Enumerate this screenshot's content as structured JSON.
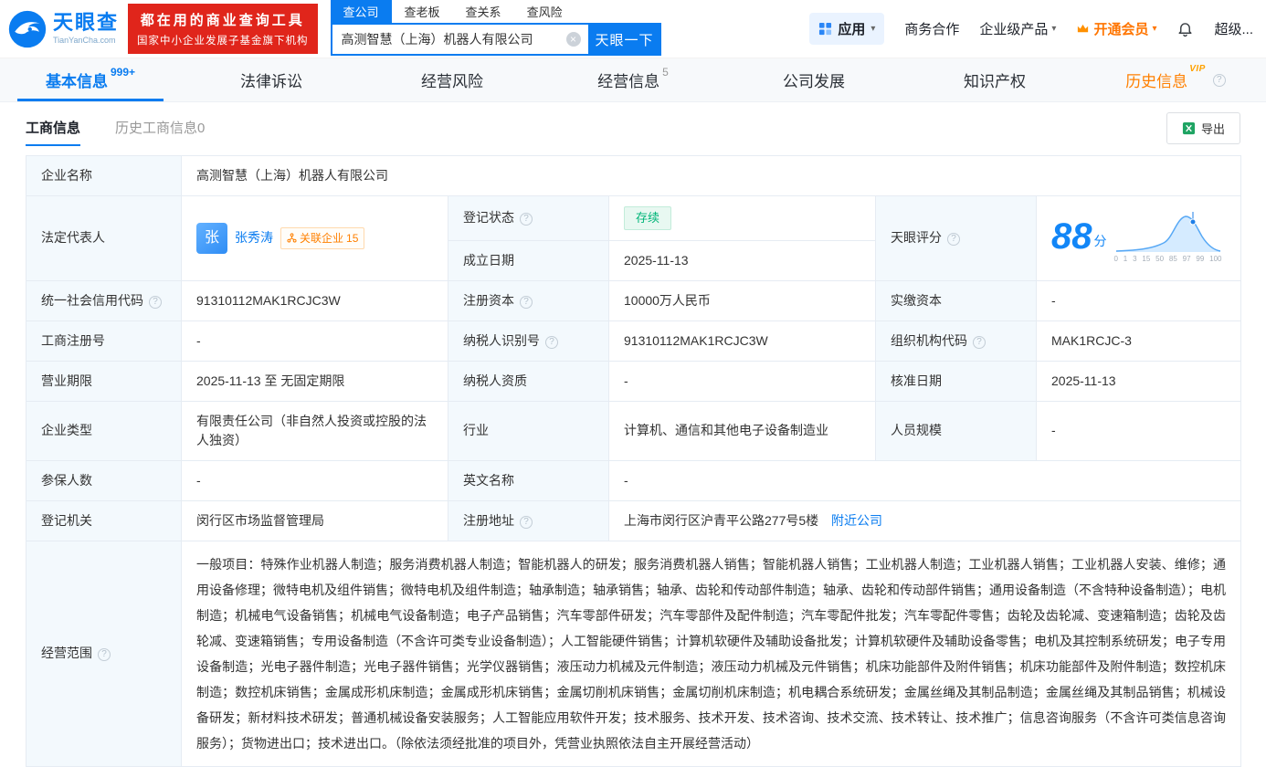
{
  "colors": {
    "primary_blue": "#0a7cf0",
    "brand_red": "#e0251b",
    "vip_orange": "#ff8000",
    "status_green": "#00b578",
    "label_bg": "#f3f9fd"
  },
  "icons": {
    "question": "?",
    "caret_down": "▾",
    "clear": "×"
  },
  "header": {
    "logo": {
      "brand": "天眼查",
      "domain": "TianYanCha.com"
    },
    "slogan": {
      "line1": "都在用的商业查询工具",
      "line2": "国家中小企业发展子基金旗下机构"
    },
    "search_tabs": [
      {
        "label": "查公司"
      },
      {
        "label": "查老板"
      },
      {
        "label": "查关系"
      },
      {
        "label": "查风险"
      }
    ],
    "search": {
      "value": "高测智慧（上海）机器人有限公司",
      "button": "天眼一下"
    },
    "menu": {
      "apps": "应用",
      "biz_coop": "商务合作",
      "enterprise": "企业级产品",
      "vip": "开通会员",
      "super": "超级..."
    }
  },
  "nav": {
    "tabs": [
      {
        "label": "基本信息",
        "badge": "999+"
      },
      {
        "label": "法律诉讼"
      },
      {
        "label": "经营风险"
      },
      {
        "label": "经营信息",
        "badge": "5"
      },
      {
        "label": "公司发展"
      },
      {
        "label": "知识产权"
      },
      {
        "label": "历史信息",
        "vip_tag": "VIP"
      }
    ]
  },
  "subtabs": [
    {
      "label": "工商信息"
    },
    {
      "label": "历史工商信息0"
    }
  ],
  "toolbar": {
    "export_label": "导出"
  },
  "fields": {
    "company_name": {
      "label": "企业名称",
      "value": "高测智慧（上海）机器人有限公司"
    },
    "legal_rep": {
      "label": "法定代表人",
      "avatar": "张",
      "name": "张秀涛",
      "related_label": "关联企业",
      "related_count": "15"
    },
    "reg_status": {
      "label": "登记状态",
      "value": "存续"
    },
    "score": {
      "label": "天眼评分",
      "value": "88",
      "unit": "分",
      "axis": [
        "0",
        "1",
        "3",
        "15",
        "50",
        "85",
        "97",
        "99",
        "100"
      ]
    },
    "establish_date": {
      "label": "成立日期",
      "value": "2025-11-13"
    },
    "credit_code": {
      "label": "统一社会信用代码",
      "value": "91310112MAK1RCJC3W"
    },
    "reg_capital": {
      "label": "注册资本",
      "value": "10000万人民币"
    },
    "paid_capital": {
      "label": "实缴资本",
      "value": "-"
    },
    "reg_number": {
      "label": "工商注册号",
      "value": "-"
    },
    "taxpayer_id": {
      "label": "纳税人识别号",
      "value": "91310112MAK1RCJC3W"
    },
    "org_code": {
      "label": "组织机构代码",
      "value": "MAK1RCJC-3"
    },
    "business_term": {
      "label": "营业期限",
      "value": "2025-11-13 至 无固定期限"
    },
    "taxpayer_quality": {
      "label": "纳税人资质",
      "value": "-"
    },
    "approval_date": {
      "label": "核准日期",
      "value": "2025-11-13"
    },
    "company_type": {
      "label": "企业类型",
      "value": "有限责任公司（非自然人投资或控股的法人独资）"
    },
    "industry": {
      "label": "行业",
      "value": "计算机、通信和其他电子设备制造业"
    },
    "staff_size": {
      "label": "人员规模",
      "value": "-"
    },
    "insured_count": {
      "label": "参保人数",
      "value": "-"
    },
    "english_name": {
      "label": "英文名称",
      "value": "-"
    },
    "reg_authority": {
      "label": "登记机关",
      "value": "闵行区市场监督管理局"
    },
    "reg_address": {
      "label": "注册地址",
      "value": "上海市闵行区沪青平公路277号5楼",
      "link_label": "附近公司"
    },
    "business_scope": {
      "label": "经营范围",
      "value": "一般项目：特殊作业机器人制造；服务消费机器人制造；智能机器人的研发；服务消费机器人销售；智能机器人销售；工业机器人制造；工业机器人销售；工业机器人安装、维修；通用设备修理；微特电机及组件销售；微特电机及组件制造；轴承制造；轴承销售；轴承、齿轮和传动部件制造；轴承、齿轮和传动部件销售；通用设备制造（不含特种设备制造）；电机制造；机械电气设备销售；机械电气设备制造；电子产品销售；汽车零部件研发；汽车零部件及配件制造；汽车零配件批发；汽车零配件零售；齿轮及齿轮减、变速箱制造；齿轮及齿轮减、变速箱销售；专用设备制造（不含许可类专业设备制造）；人工智能硬件销售；计算机软硬件及辅助设备批发；计算机软硬件及辅助设备零售；电机及其控制系统研发；电子专用设备制造；光电子器件制造；光电子器件销售；光学仪器销售；液压动力机械及元件制造；液压动力机械及元件销售；机床功能部件及附件销售；机床功能部件及附件制造；数控机床制造；数控机床销售；金属成形机床制造；金属成形机床销售；金属切削机床销售；金属切削机床制造；机电耦合系统研发；金属丝绳及其制品制造；金属丝绳及其制品销售；机械设备研发；新材料技术研发；普通机械设备安装服务；人工智能应用软件开发；技术服务、技术开发、技术咨询、技术交流、技术转让、技术推广；信息咨询服务（不含许可类信息咨询服务）；货物进出口；技术进出口。（除依法须经批准的项目外，凭营业执照依法自主开展经营活动）"
    }
  }
}
